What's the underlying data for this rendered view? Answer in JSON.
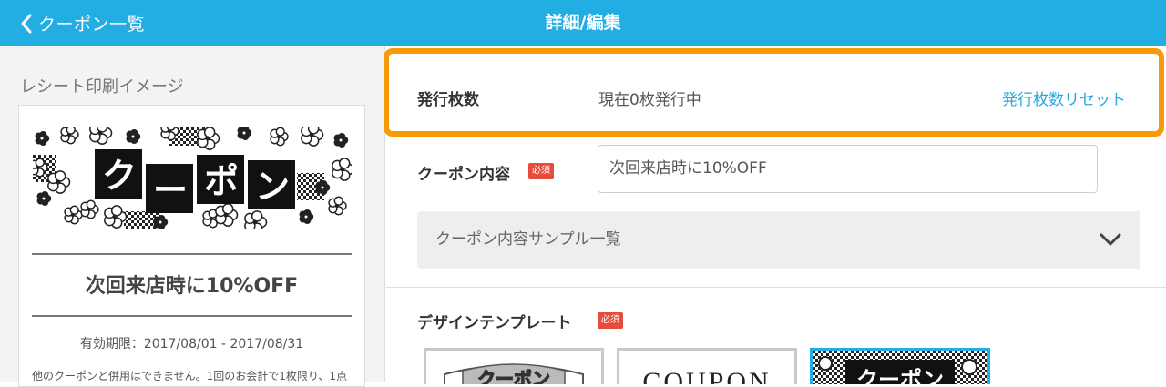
{
  "header": {
    "back_label": "クーポン一覧",
    "title": "詳細/編集"
  },
  "preview": {
    "section_title": "レシート印刷イメージ",
    "banner_text": "クーポン",
    "coupon_title": "次回来店時に10%OFF",
    "expiry": "有効期限：2017/08/01 - 2017/08/31",
    "note": "他のクーポンと併用はできません。1回のお会計で1枚限り、1点"
  },
  "form": {
    "issue_count": {
      "label": "発行枚数",
      "value": "現在0枚発行中",
      "reset_link": "発行枚数リセット"
    },
    "coupon_content": {
      "label": "クーポン内容",
      "required_badge": "必須",
      "value": "次回来店時に10%OFF"
    },
    "sample_dropdown": {
      "label": "クーポン内容サンプル一覧"
    },
    "design_template": {
      "label": "デザインテンプレート",
      "required_badge": "必須",
      "templates": [
        {
          "text": "クーポン",
          "selected": false
        },
        {
          "text": "COUPON",
          "selected": false
        },
        {
          "text": "クーポン",
          "selected": true
        }
      ]
    }
  },
  "colors": {
    "header_bg": "#23aee3",
    "highlight_border": "#f79a09",
    "link": "#2aa7df",
    "required_badge": "#e64b3c"
  }
}
